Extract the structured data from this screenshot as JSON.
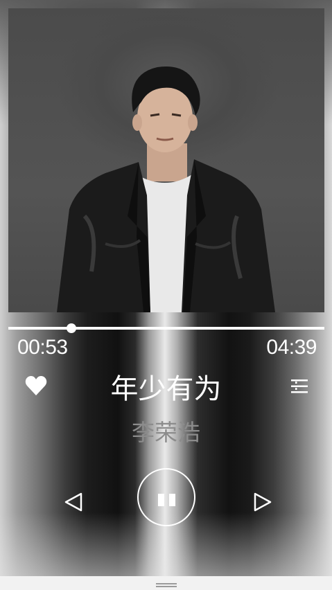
{
  "player": {
    "song_title": "年少有为",
    "artist": "李荣浩",
    "current_time": "00:53",
    "total_time": "04:39",
    "progress_fraction": 0.2
  },
  "controls": {
    "favorite_icon": "heart-icon",
    "playlist_icon": "playlist-menu-icon",
    "prev_icon": "previous-triangle-icon",
    "play_pause_icon": "pause-icon",
    "next_icon": "next-triangle-icon"
  },
  "colors": {
    "text": "#ffffff",
    "artist_text": "#8c8c8c",
    "progress": "#ffffff"
  }
}
